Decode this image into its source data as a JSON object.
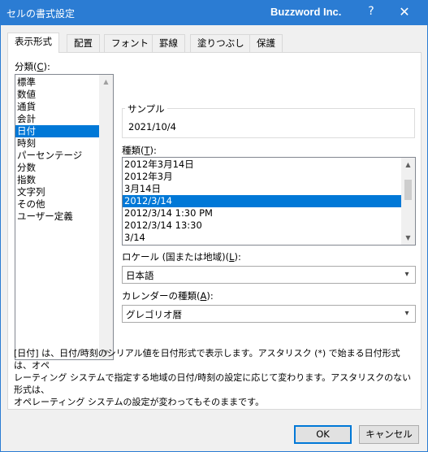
{
  "titlebar": {
    "title": "セルの書式設定",
    "app_name": "Buzzword Inc.",
    "help_label": "?",
    "close_label": "✕"
  },
  "tabs": [
    {
      "label": "表示形式",
      "active": true
    },
    {
      "label": "配置",
      "active": false
    },
    {
      "label": "フォント",
      "active": false
    },
    {
      "label": "罫線",
      "active": false
    },
    {
      "label": "塗りつぶし",
      "active": false
    },
    {
      "label": "保護",
      "active": false
    }
  ],
  "category": {
    "label": "分類(",
    "accel": "C",
    "label_end": "):",
    "items": [
      "標準",
      "数値",
      "通貨",
      "会計",
      "日付",
      "時刻",
      "パーセンテージ",
      "分数",
      "指数",
      "文字列",
      "その他",
      "ユーザー定義"
    ],
    "selected": "日付"
  },
  "sample": {
    "label": "サンプル",
    "value": "2021/10/4"
  },
  "type": {
    "label": "種類(",
    "accel": "T",
    "label_end": "):",
    "items": [
      "2012年3月14日",
      "2012年3月",
      "3月14日",
      "2012/3/14",
      "2012/3/14 1:30 PM",
      "2012/3/14 13:30",
      "3/14"
    ],
    "selected": "2012/3/14"
  },
  "locale": {
    "label": "ロケール (国または地域)(",
    "accel": "L",
    "label_end": "):",
    "value": "日本語"
  },
  "calendar": {
    "label": "カレンダーの種類(",
    "accel": "A",
    "label_end": "):",
    "value": "グレゴリオ暦"
  },
  "description": {
    "line1": "[日付] は、日付/時刻のシリアル値を日付形式で表示します。アスタリスク (*) で始まる日付形式は、オペ",
    "line2": "レーティング システムで指定する地域の日付/時刻の設定に応じて変わります。アスタリスクのない形式は、",
    "line3": "オペレーティング システムの設定が変わってもそのままです。"
  },
  "buttons": {
    "ok": "OK",
    "cancel": "キャンセル"
  },
  "icons": {
    "scroll_up": "▲",
    "scroll_down": "▼",
    "dropdown": "▾"
  },
  "colors": {
    "titlebar": "#2b7cd3",
    "selection": "#0078d7"
  }
}
